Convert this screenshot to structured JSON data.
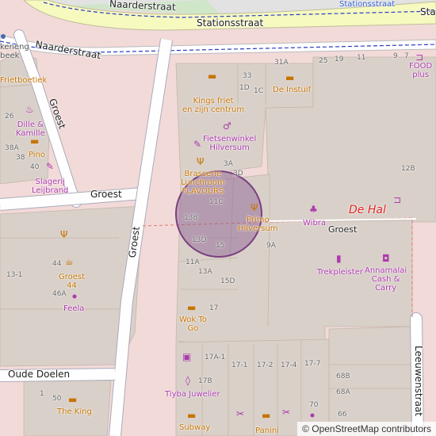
{
  "map": {
    "streets": {
      "stationsstraat_left": "Stationsstraat",
      "stationsstraat_right": "Stat",
      "naarderstraat_top": "Naarderstraat",
      "naarderstraat_mid": "Naarderstraat",
      "stationsstraat_rail": "Stationsstraat",
      "groest_vertical_left": "Groest",
      "groest_horizontal": "Groest",
      "groest_diag": "Groest",
      "groest_right": "Groest",
      "oude_doelen": "Oude Doelen",
      "leeuwenstraat": "Leeuwenstraat"
    },
    "pois": {
      "kikeneng": "keneng\nbeek",
      "frietboetiek": "Frietboetiek",
      "dille_kamille": "Dille &\nKamille",
      "pino": "Pino",
      "slagerij": "Slagerij\nLeijbrand",
      "kings_friet": "Kings friet\nen zijn centrum",
      "de_instuif": "De Instuif",
      "fietsenwinkel": "Fietsenwinkel\nHilversum",
      "brasserie": "Brasserie\nLunchroom\nFLAVOURS",
      "primo": "Primo\nHilversum",
      "wibra": "Wibra",
      "de_hal": "De Hal",
      "trekpleister": "Trekpleister",
      "annamalai": "Annamalai\nCash &\nCarry",
      "food_plus": "FOOD\nplus",
      "groest44": "Groest\n44",
      "feela": "Feela",
      "wok_to_go": "Wok To\nGo",
      "tiyba": "Tiyba Juwelier",
      "subway": "Subway",
      "the_king": "The King",
      "panini": "Panini"
    },
    "house_numbers": {
      "n26": "26",
      "n38a": "38A",
      "n38": "38",
      "n40": "40",
      "n33": "33",
      "n1d": "1D",
      "n1c": "1C",
      "n31a": "31A",
      "n25": "25",
      "n19": "19",
      "n11": "11",
      "n9": "9",
      "n7": "7",
      "n3a": "3A",
      "n3d": "3D",
      "n12b": "12B",
      "n11c": "11C",
      "n13b": "13B",
      "n13d": "13D",
      "n15": "15",
      "n9a": "9A",
      "n11a": "11A",
      "n13a": "13A",
      "n15d": "15D",
      "n17": "17",
      "n44": "44",
      "n13_1": "13-1",
      "n46a": "46A",
      "n17a1": "17A-1",
      "n17b": "17B",
      "n17_1": "17-1",
      "n17_2": "17-2",
      "n17_4": "17-4",
      "n17_7": "17-7",
      "n68b": "68B",
      "n68a": "68A",
      "n70": "70",
      "n66": "66",
      "n1": "1",
      "n50": "50"
    },
    "attribution_prefix": "© ",
    "attribution_link": "OpenStreetMap contributors"
  }
}
